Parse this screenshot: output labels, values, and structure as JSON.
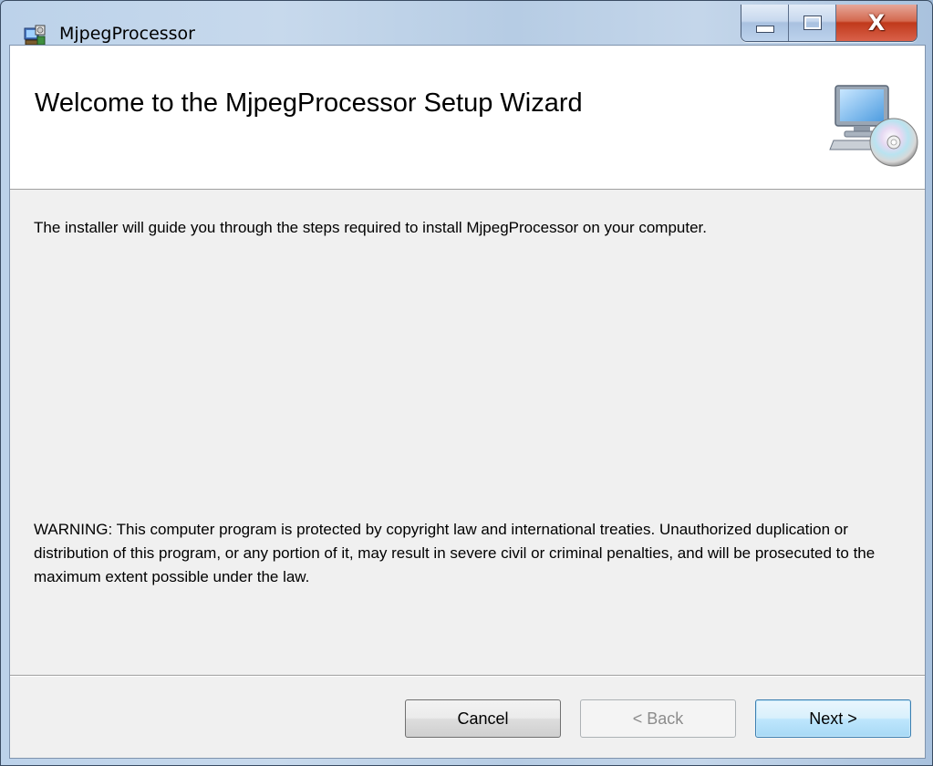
{
  "window": {
    "title": "MjpegProcessor",
    "controls": {
      "minimize": "minimize",
      "maximize": "maximize",
      "close": "X"
    }
  },
  "banner": {
    "title": "Welcome to the MjpegProcessor Setup Wizard",
    "icon": "computer-cd-icon"
  },
  "body": {
    "intro": "The installer will guide you through the steps required to install MjpegProcessor on your computer.",
    "warning": "WARNING: This computer program is protected by copyright law and international treaties. Unauthorized duplication or distribution of this program, or any portion of it, may result in severe civil or criminal penalties, and will be prosecuted to the maximum extent possible under the law."
  },
  "buttons": {
    "cancel": "Cancel",
    "back": "< Back",
    "next": "Next >"
  },
  "colors": {
    "accent": "#3c7fb1",
    "close": "#c0391b",
    "client_bg": "#f0f0f0"
  }
}
